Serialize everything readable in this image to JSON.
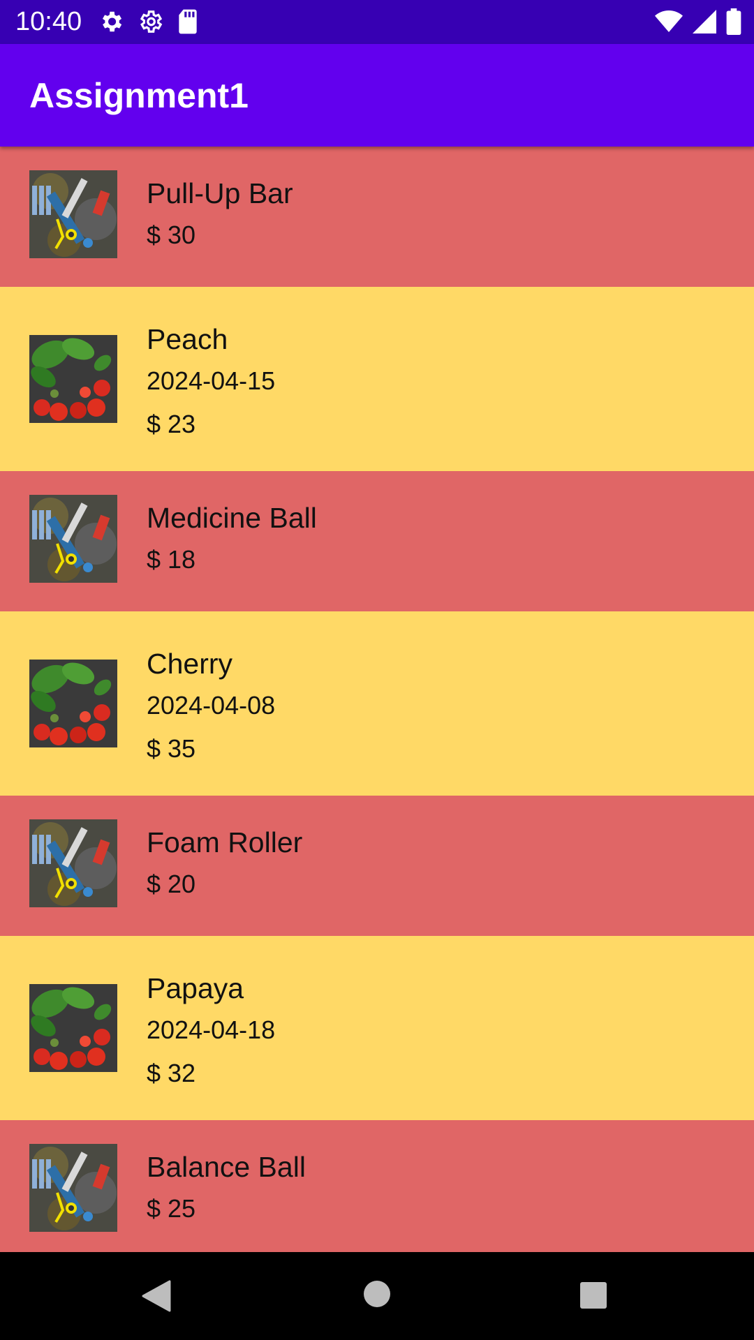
{
  "status_bar": {
    "time": "10:40",
    "left_icons": [
      "gear-icon",
      "gear-icon",
      "sd-card-icon"
    ],
    "right_icons": [
      "wifi-icon",
      "signal-icon",
      "battery-icon"
    ]
  },
  "app_bar": {
    "title": "Assignment1"
  },
  "colors": {
    "status_bar": "#3700B3",
    "app_bar": "#6200EE",
    "row_red": "#E06666",
    "row_yellow": "#FFD966"
  },
  "items": [
    {
      "name": "Pull-Up Bar",
      "price": "$ 30",
      "image": "tools-image"
    },
    {
      "name": "Peach",
      "date": "2024-04-15",
      "price": "$ 23",
      "image": "vegetables-image"
    },
    {
      "name": "Medicine Ball",
      "price": "$ 18",
      "image": "tools-image"
    },
    {
      "name": "Cherry",
      "date": "2024-04-08",
      "price": "$ 35",
      "image": "vegetables-image"
    },
    {
      "name": "Foam Roller",
      "price": "$ 20",
      "image": "tools-image"
    },
    {
      "name": "Papaya",
      "date": "2024-04-18",
      "price": "$ 32",
      "image": "vegetables-image"
    },
    {
      "name": "Balance Ball",
      "price": "$ 25",
      "image": "tools-image"
    }
  ],
  "nav_bar": {
    "buttons": [
      "back-icon",
      "home-icon",
      "recents-icon"
    ]
  }
}
